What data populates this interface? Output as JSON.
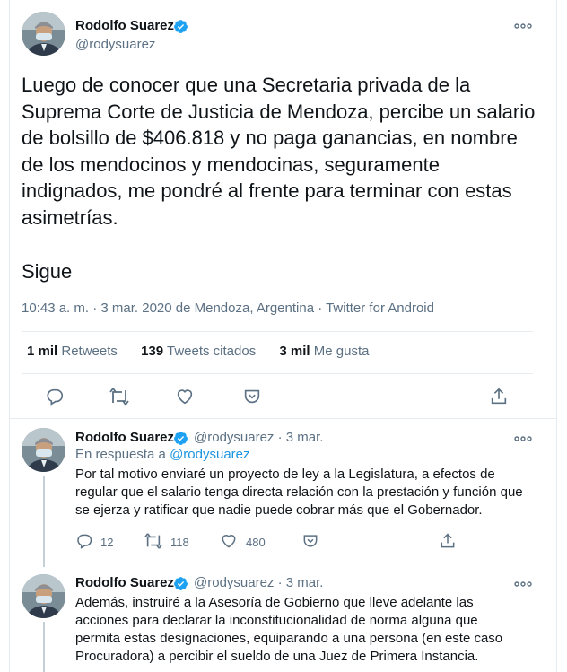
{
  "main_tweet": {
    "author_name": "Rodolfo Suarez",
    "handle": "@rodysuarez",
    "text": "Luego de conocer que una Secretaria privada de la Suprema Corte de Justicia de Mendoza, percibe un salario de bolsillo de $406.818 y no paga ganancias, en nombre de los mendocinos y mendocinas, seguramente indignados, me pondré al frente para terminar con estas asimetrías.",
    "continuation": "Sigue",
    "meta": "10:43 a. m. · 3 mar. 2020 de Mendoza, Argentina · Twitter for Android",
    "stats": {
      "retweets_count": "1 mil",
      "retweets_label": "Retweets",
      "quotes_count": "139",
      "quotes_label": "Tweets citados",
      "likes_count": "3 mil",
      "likes_label": "Me gusta"
    }
  },
  "replies": [
    {
      "author_name": "Rodolfo Suarez",
      "handle": "@rodysuarez",
      "sep": "·",
      "date": "3 mar.",
      "in_reply_prefix": "En respuesta a",
      "in_reply_handle": "@rodysuarez",
      "text": "Por tal motivo enviaré un proyecto de ley a la Legislatura, a efectos de regular que el salario tenga directa relación con la prestación y función que se ejerza y ratificar que nadie puede cobrar más que el Gobernador.",
      "reply_count": "12",
      "retweet_count": "118",
      "like_count": "480"
    },
    {
      "author_name": "Rodolfo Suarez",
      "handle": "@rodysuarez",
      "sep": "·",
      "date": "3 mar.",
      "text": "Además, instruiré a la Asesoría de Gobierno que lleve adelante las acciones para declarar la inconstitucionalidad de norma alguna que permita estas designaciones, equiparando a una persona (en este caso Procuradora) a percibir el sueldo de una Juez de Primera Instancia."
    }
  ],
  "colors": {
    "accent": "#1da1f2",
    "muted": "#5b7083",
    "border": "#e6ecf0"
  }
}
